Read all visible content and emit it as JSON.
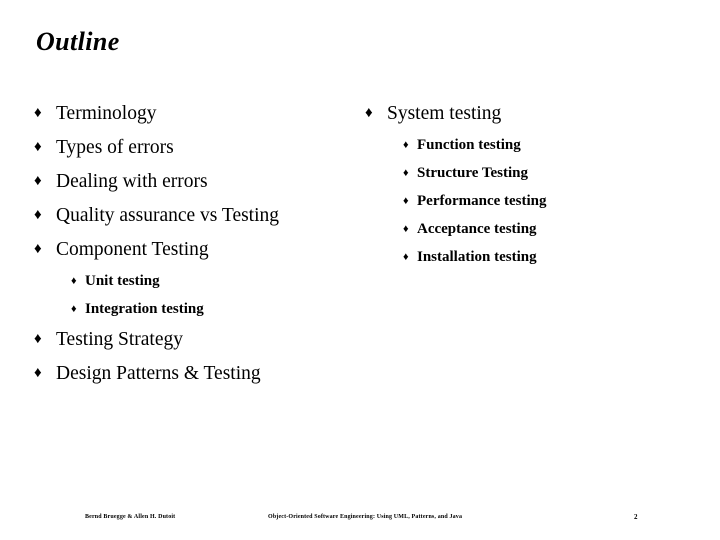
{
  "slide": {
    "title": "Outline",
    "bullet_marker": "♦",
    "sub_bullet_marker": "♦",
    "background_color": "#ffffff",
    "text_color": "#000000",
    "left_column": [
      {
        "level": 1,
        "text": "Terminology"
      },
      {
        "level": 1,
        "text": "Types of errors"
      },
      {
        "level": 1,
        "text": "Dealing with errors"
      },
      {
        "level": 1,
        "text": "Quality assurance vs Testing"
      },
      {
        "level": 1,
        "text": "Component Testing"
      },
      {
        "level": 2,
        "text": "Unit testing"
      },
      {
        "level": 2,
        "text": "Integration testing"
      },
      {
        "level": 1,
        "text": "Testing Strategy"
      },
      {
        "level": 1,
        "text": "Design Patterns & Testing"
      }
    ],
    "right_column": [
      {
        "level": 1,
        "text": "System testing"
      },
      {
        "level": 2,
        "text": "Function testing"
      },
      {
        "level": 2,
        "text": "Structure Testing"
      },
      {
        "level": 2,
        "text": "Performance testing"
      },
      {
        "level": 2,
        "text": "Acceptance testing"
      },
      {
        "level": 2,
        "text": "Installation testing"
      }
    ]
  },
  "footer": {
    "authors": "Bernd Bruegge & Allen H. Dutoit",
    "book_title": "Object-Oriented Software Engineering: Using UML, Patterns, and Java",
    "page_number": "2"
  }
}
